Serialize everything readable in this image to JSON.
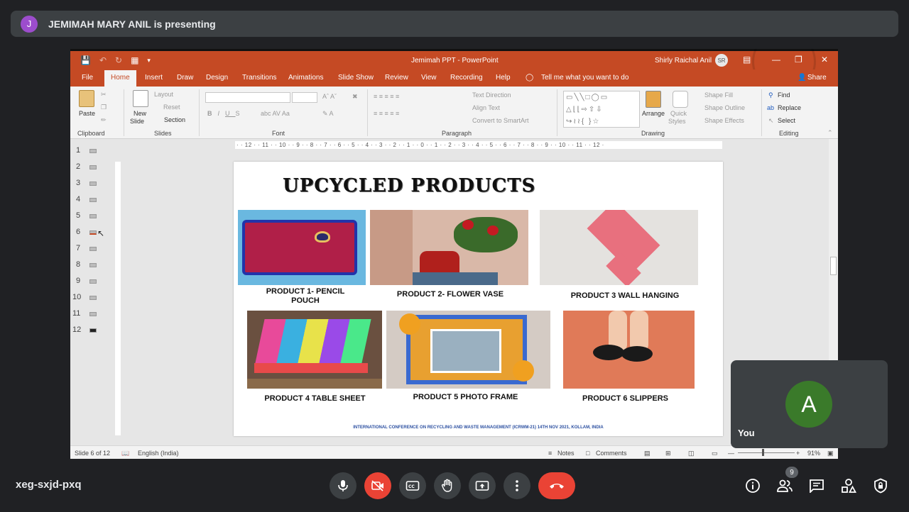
{
  "presenter": {
    "initial": "J",
    "text": "JEMIMAH MARY ANIL is presenting"
  },
  "powerpoint": {
    "window_title": "Jemimah PPT  -  PowerPoint",
    "user_name": "Shirly Raichal Anil",
    "user_initials": "SR",
    "tabs": [
      "File",
      "Home",
      "Insert",
      "Draw",
      "Design",
      "Transitions",
      "Animations",
      "Slide Show",
      "Review",
      "View",
      "Recording",
      "Help"
    ],
    "tell_me": "Tell me what you want to do",
    "share": "Share",
    "ribbon": {
      "clipboard": {
        "paste": "Paste",
        "label": "Clipboard"
      },
      "slides": {
        "new_slide_1": "New",
        "new_slide_2": "Slide",
        "layout": "Layout",
        "reset": "Reset",
        "section": "Section",
        "label": "Slides"
      },
      "font": {
        "label": "Font"
      },
      "paragraph": {
        "text_direction": "Text Direction",
        "align_text": "Align Text",
        "convert_smartart": "Convert to SmartArt",
        "label": "Paragraph"
      },
      "drawing": {
        "arrange": "Arrange",
        "quick_styles_1": "Quick",
        "quick_styles_2": "Styles",
        "shape_fill": "Shape Fill",
        "shape_outline": "Shape Outline",
        "shape_effects": "Shape Effects",
        "label": "Drawing"
      },
      "editing": {
        "find": "Find",
        "replace": "Replace",
        "select": "Select",
        "label": "Editing"
      }
    },
    "slide_numbers": [
      "1",
      "2",
      "3",
      "4",
      "5",
      "6",
      "7",
      "8",
      "9",
      "10",
      "11",
      "12"
    ],
    "ruler": "· · 12 · · 11 · · 10 · · 9 · · 8 · · 7 · · 6 · · 5 · · 4 · · 3 · · 2 · · 1 · · 0 · · 1 · · 2 · · 3 · · 4 · · 5 · · 6 · · 7 · · 8 · · 9 · · 10 · · 11 · · 12 ·",
    "slide": {
      "title": "UPCYCLED PRODUCTS",
      "products": [
        {
          "line1": "PRODUCT 1- PENCIL",
          "line2": "POUCH"
        },
        {
          "line1": "PRODUCT 2- FLOWER VASE",
          "line2": ""
        },
        {
          "line1": "PRODUCT 3 WALL HANGING",
          "line2": ""
        },
        {
          "line1": "PRODUCT 4 TABLE SHEET",
          "line2": ""
        },
        {
          "line1": "PRODUCT 5 PHOTO FRAME",
          "line2": ""
        },
        {
          "line1": "PRODUCT 6 SLIPPERS",
          "line2": ""
        }
      ],
      "footer": "INTERNATIONAL CONFERENCE ON RECYCLING AND WASTE MANAGEMENT (ICRWM-21) 14TH NOV 2021, KOLLAM, INDIA"
    },
    "status": {
      "slide_of": "Slide 6 of 12",
      "language": "English (India)",
      "notes": "Notes",
      "comments": "Comments",
      "zoom": "91%"
    }
  },
  "self_tile": {
    "initial": "A",
    "label": "You"
  },
  "meeting": {
    "code": "xeg-sxjd-pxq",
    "participants_count": "9",
    "colors": {
      "end_call": "#ea4335",
      "ppt_accent": "#c54a24"
    }
  }
}
